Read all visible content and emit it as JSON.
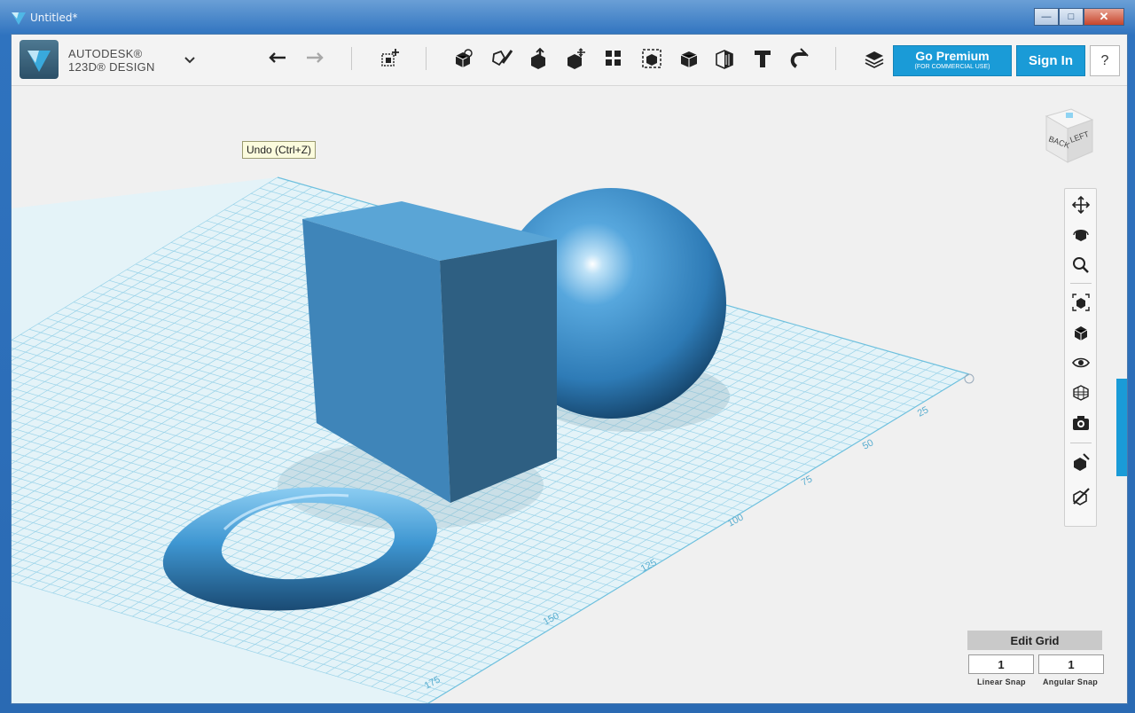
{
  "window": {
    "title": "Untitled*"
  },
  "brand": {
    "line1": "AUTODESK®",
    "line2": "123D® DESIGN"
  },
  "toolbar": {
    "tools": [
      {
        "name": "undo",
        "icon": "undo-icon"
      },
      {
        "name": "redo",
        "icon": "redo-icon"
      },
      {
        "name": "transform",
        "icon": "transform-icon"
      },
      {
        "name": "primitives",
        "icon": "primitives-icon"
      },
      {
        "name": "sketch",
        "icon": "sketch-icon"
      },
      {
        "name": "construct",
        "icon": "construct-icon"
      },
      {
        "name": "modify",
        "icon": "modify-icon"
      },
      {
        "name": "pattern",
        "icon": "pattern-icon"
      },
      {
        "name": "grouping",
        "icon": "grouping-icon"
      },
      {
        "name": "combine",
        "icon": "combine-icon"
      },
      {
        "name": "measure",
        "icon": "measure-icon"
      },
      {
        "name": "text",
        "icon": "text-icon"
      },
      {
        "name": "snap",
        "icon": "snap-icon"
      },
      {
        "name": "material",
        "icon": "material-icon"
      }
    ],
    "premium_label": "Go Premium",
    "premium_sub": "(FOR COMMERCIAL USE)",
    "signin_label": "Sign In",
    "help_label": "?"
  },
  "tooltip": {
    "text": "Undo (Ctrl+Z)"
  },
  "viewcube": {
    "face_left": "LEFT",
    "face_back": "BACK"
  },
  "grid_labels": [
    "25",
    "50",
    "75",
    "100",
    "125",
    "150",
    "175"
  ],
  "nav_tools": [
    "pan-icon",
    "orbit-icon",
    "zoom-icon",
    "fit-icon",
    "views-icon",
    "visibility-icon",
    "material-view-icon",
    "capture-icon",
    "component-icon",
    "hide-icon"
  ],
  "snap": {
    "edit_grid_label": "Edit Grid",
    "linear_value": "1",
    "angular_value": "1",
    "linear_label": "Linear Snap",
    "angular_label": "Angular Snap"
  },
  "colors": {
    "accent": "#1a9bd7",
    "model": "#3f8fc9",
    "grid": "#8fd0ea"
  }
}
